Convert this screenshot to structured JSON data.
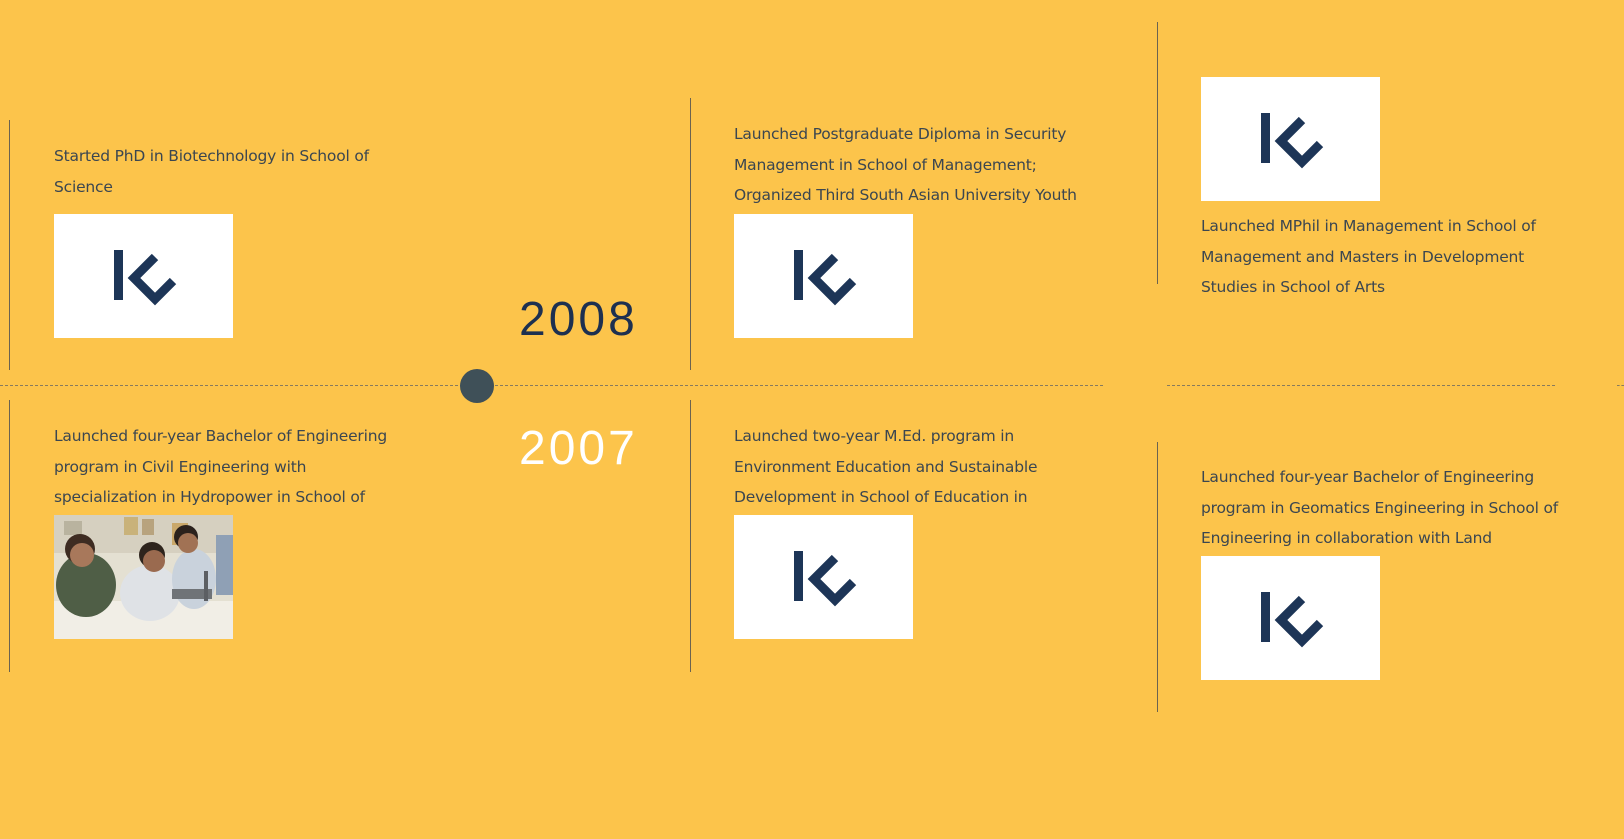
{
  "timeline": {
    "years": {
      "upper": "2008",
      "lower": "2007"
    },
    "entries_2008": [
      {
        "text": "Started PhD in Biotechnology in School of Science",
        "image": "ku-logo"
      },
      {
        "text": "Launched Postgraduate Diploma in Security Management in School of Management; Organized Third South Asian University Youth",
        "image": "ku-logo"
      },
      {
        "text": "Launched MPhil in Management in School of Management and Masters in Development Studies in School of Arts",
        "image": "ku-logo"
      }
    ],
    "entries_2007": [
      {
        "text": "Launched four-year Bachelor of Engineering program in Civil Engineering with specialization in Hydropower in School of",
        "image": "students-photo"
      },
      {
        "text": "Launched two-year M.Ed. program in Environment Education and Sustainable Development in School of Education in",
        "image": "ku-logo"
      },
      {
        "text": "Launched four-year Bachelor of Engineering program in Geomatics Engineering in School of Engineering in collaboration with Land",
        "image": "ku-logo"
      }
    ]
  },
  "colors": {
    "background": "#fcc44b",
    "logo": "#1d3557",
    "dot": "#3f5058"
  }
}
